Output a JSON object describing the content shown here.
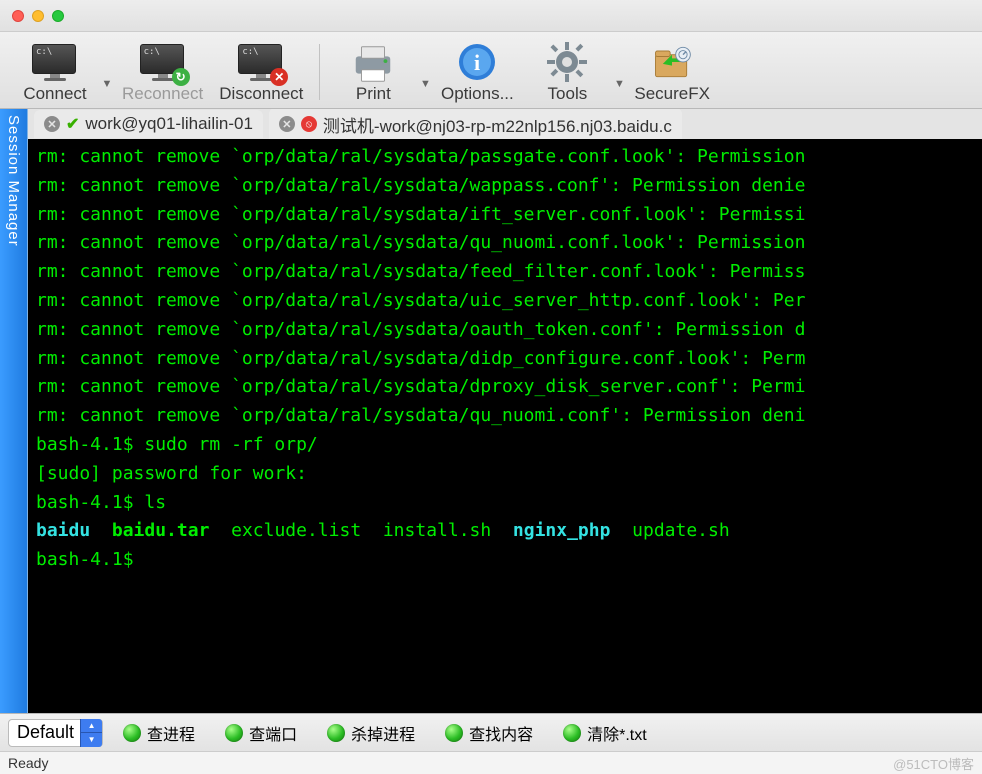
{
  "toolbar": {
    "connect": "Connect",
    "reconnect": "Reconnect",
    "disconnect": "Disconnect",
    "print": "Print",
    "options": "Options...",
    "tools": "Tools",
    "securefx": "SecureFX"
  },
  "session_manager_label": "Session Manager",
  "tabs": [
    {
      "title": "work@yq01-lihailin-01",
      "status": "ok"
    },
    {
      "title": "测试机-work@nj03-rp-m22nlp156.nj03.baidu.c",
      "status": "blocked"
    }
  ],
  "terminal_lines": [
    {
      "t": "rm: cannot remove `orp/data/ral/sysdata/passgate.conf.look': Permission"
    },
    {
      "t": "rm: cannot remove `orp/data/ral/sysdata/wappass.conf': Permission denie"
    },
    {
      "t": "rm: cannot remove `orp/data/ral/sysdata/ift_server.conf.look': Permissi"
    },
    {
      "t": "rm: cannot remove `orp/data/ral/sysdata/qu_nuomi.conf.look': Permission"
    },
    {
      "t": "rm: cannot remove `orp/data/ral/sysdata/feed_filter.conf.look': Permiss"
    },
    {
      "t": "rm: cannot remove `orp/data/ral/sysdata/uic_server_http.conf.look': Per"
    },
    {
      "t": "rm: cannot remove `orp/data/ral/sysdata/oauth_token.conf': Permission d"
    },
    {
      "t": "rm: cannot remove `orp/data/ral/sysdata/didp_configure.conf.look': Perm"
    },
    {
      "t": "rm: cannot remove `orp/data/ral/sysdata/dproxy_disk_server.conf': Permi"
    },
    {
      "t": "rm: cannot remove `orp/data/ral/sysdata/qu_nuomi.conf': Permission deni"
    },
    {
      "t": "bash-4.1$ sudo rm -rf orp/"
    },
    {
      "t": "[sudo] password for work:"
    },
    {
      "t": "bash-4.1$ ls"
    }
  ],
  "ls_output": [
    {
      "name": "baidu",
      "style": "bold cyan"
    },
    {
      "name": "baidu.tar",
      "style": "bold"
    },
    {
      "name": "exclude.list",
      "style": ""
    },
    {
      "name": "install.sh",
      "style": ""
    },
    {
      "name": "nginx_php",
      "style": "bold cyan"
    },
    {
      "name": "update.sh",
      "style": ""
    }
  ],
  "prompt_after": "bash-4.1$",
  "bottom": {
    "combo": "Default",
    "items": [
      "查进程",
      "查端口",
      "杀掉进程",
      "查找内容",
      "清除*.txt"
    ]
  },
  "status": {
    "left": "Ready",
    "right": "@51CTO博客"
  }
}
